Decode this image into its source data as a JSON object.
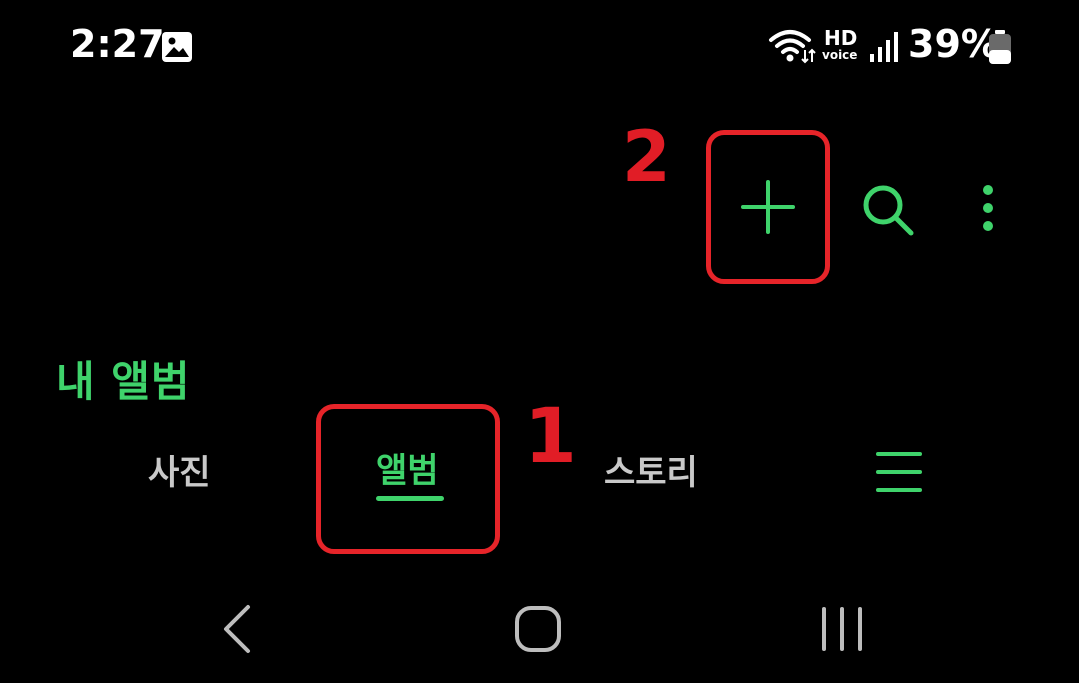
{
  "status_bar": {
    "time": "2:27",
    "hd_label": "HD",
    "voice_label": "voice",
    "battery_percent": "39%",
    "icons": [
      "gallery-icon",
      "wifi-icon",
      "hd-voice-icon",
      "signal-icon",
      "battery-icon"
    ]
  },
  "toolbar": {
    "icons": [
      "add-icon",
      "search-icon",
      "more-vert-icon"
    ]
  },
  "annotations": {
    "first": "1",
    "second": "2"
  },
  "page": {
    "title": "내 앨범"
  },
  "tabs": [
    {
      "label": "사진",
      "selected": false
    },
    {
      "label": "앨범",
      "selected": true
    },
    {
      "label": "스토리",
      "selected": false
    }
  ],
  "nav_bar": {
    "icons": [
      "back-icon",
      "home-icon",
      "recents-icon"
    ]
  },
  "colors": {
    "background": "#000000",
    "accent": "#3fd36b",
    "annotation": "#e11d26",
    "inactive_tab": "#c9c9c9",
    "nav_icons": "#bdbdbd"
  }
}
